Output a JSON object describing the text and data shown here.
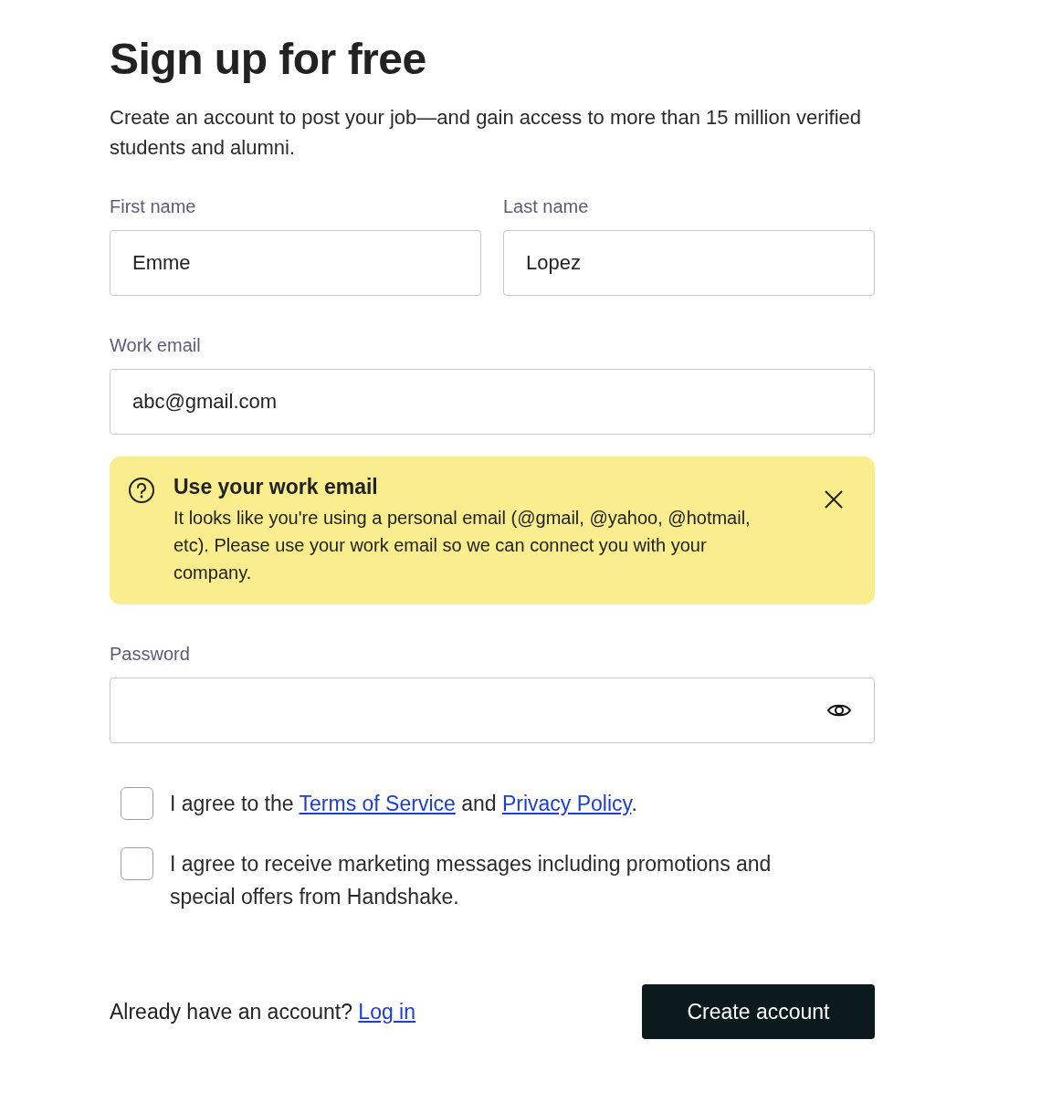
{
  "title": "Sign up for free",
  "subtitle": "Create an account to post your job—and gain access to more than 15 million verified students and alumni.",
  "name_fields": [
    {
      "label": "First name",
      "value": "Emme"
    },
    {
      "label": "Last name",
      "value": "Lopez"
    }
  ],
  "email_field": {
    "label": "Work email",
    "value": "abc@gmail.com"
  },
  "alert": {
    "title": "Use your work email",
    "message": "It looks like you're using a personal email (@gmail, @yahoo, @hotmail, etc). Please use your work email so we can connect you with your company."
  },
  "password_field": {
    "label": "Password"
  },
  "agreements": [
    {
      "checked": false,
      "parts": [
        {
          "kind": "text",
          "text": "I agree to the "
        },
        {
          "kind": "link",
          "text": "Terms of Service"
        },
        {
          "kind": "text",
          "text": " and "
        },
        {
          "kind": "link",
          "text": "Privacy Policy"
        },
        {
          "kind": "text",
          "text": "."
        }
      ]
    },
    {
      "checked": false,
      "parts": [
        {
          "kind": "text",
          "text": "I agree to receive marketing messages including promotions and special offers from Handshake."
        }
      ]
    }
  ],
  "footer": {
    "prompt": "Already have an account?",
    "link": "Log in",
    "button": "Create account"
  }
}
